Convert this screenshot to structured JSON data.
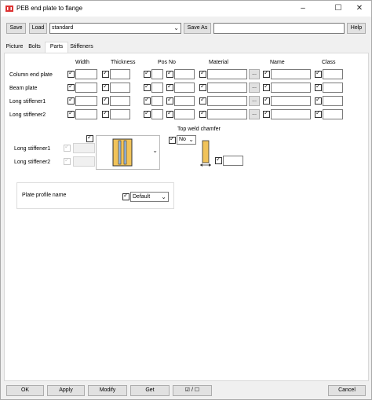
{
  "window": {
    "title": "PEB end plate to flange",
    "minimize": "–",
    "maximize": "☐",
    "close": "✕"
  },
  "toolbar": {
    "save": "Save",
    "load": "Load",
    "preset": "standard",
    "save_as": "Save As",
    "save_as_name": "",
    "help": "Help"
  },
  "tabs": [
    "Picture",
    "Bolts",
    "Parts",
    "Stiffeners"
  ],
  "parts": {
    "headers": {
      "width": "Width",
      "thickness": "Thickness",
      "pos_no": "Pos No",
      "material": "Material",
      "name": "Name",
      "class": "Class"
    },
    "rows": [
      {
        "label": "Column end plate"
      },
      {
        "label": "Beam plate"
      },
      {
        "label": "Long stiffener1"
      },
      {
        "label": "Long stiffener2"
      }
    ],
    "browse": "..."
  },
  "profile_section": {
    "stiff1_label": "Long stiffener1",
    "stiff2_label": "Long stiffener2"
  },
  "top_weld": {
    "label": "Top weld chamfer",
    "value": "No"
  },
  "plate_profile": {
    "label": "Plate profile name",
    "value": "Default"
  },
  "footer": {
    "ok": "OK",
    "apply": "Apply",
    "modify": "Modify",
    "get": "Get",
    "toggle": "☑ / ☐",
    "cancel": "Cancel"
  },
  "colors": {
    "plate_fill": "#f1c35a",
    "plate_stroke": "#333333",
    "stiffener_blue": "#9bbbe0"
  }
}
